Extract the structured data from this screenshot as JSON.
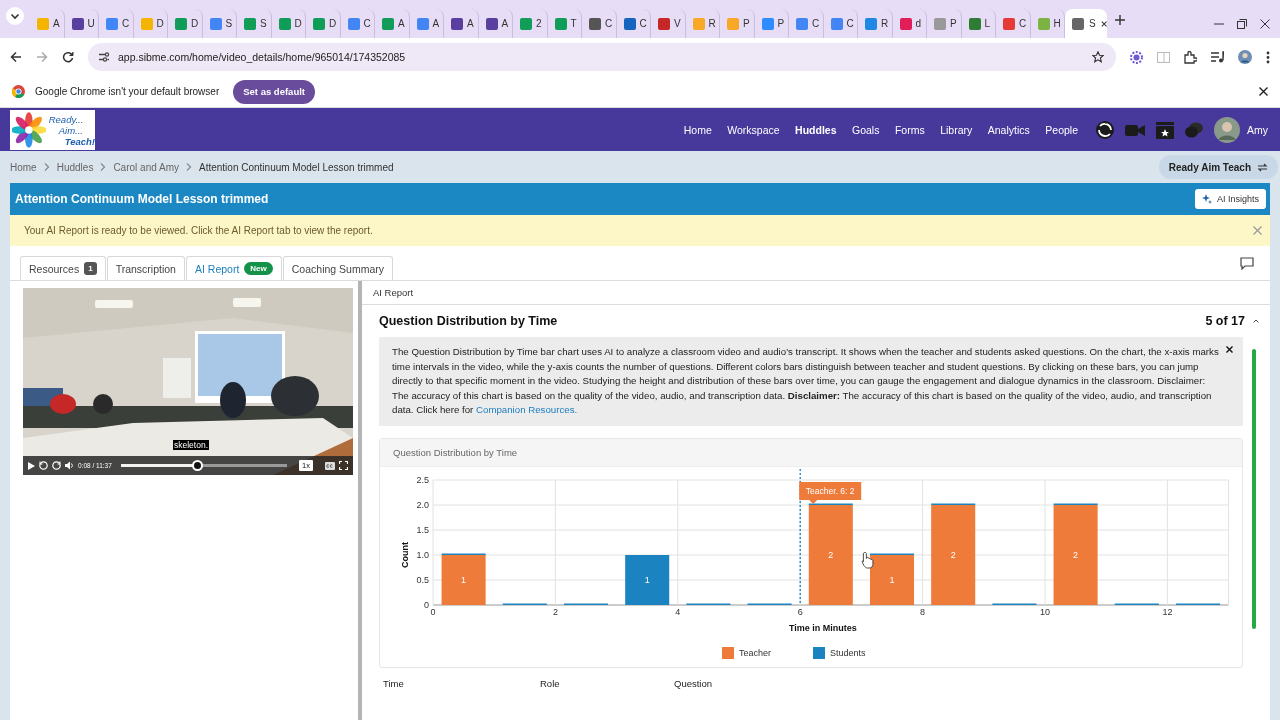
{
  "browser": {
    "tabs": [
      {
        "label": "A",
        "color": "#f4b400",
        "selected": false
      },
      {
        "label": "U",
        "color": "#5b3fa0",
        "selected": false
      },
      {
        "label": "C",
        "color": "#4285f4",
        "selected": false
      },
      {
        "label": "D",
        "color": "#f4b400",
        "selected": false
      },
      {
        "label": "D",
        "color": "#0f9d58",
        "selected": false
      },
      {
        "label": "S",
        "color": "#4285f4",
        "selected": false
      },
      {
        "label": "S",
        "color": "#0f9d58",
        "selected": false
      },
      {
        "label": "D",
        "color": "#0f9d58",
        "selected": false
      },
      {
        "label": "D",
        "color": "#0f9d58",
        "selected": false
      },
      {
        "label": "C",
        "color": "#4285f4",
        "selected": false
      },
      {
        "label": "A",
        "color": "#0f9d58",
        "selected": false
      },
      {
        "label": "A",
        "color": "#4285f4",
        "selected": false
      },
      {
        "label": "A",
        "color": "#5b3fa0",
        "selected": false
      },
      {
        "label": "A",
        "color": "#5b3fa0",
        "selected": false
      },
      {
        "label": "2",
        "color": "#0f9d58",
        "selected": false
      },
      {
        "label": "T",
        "color": "#0f9d58",
        "selected": false
      },
      {
        "label": "C",
        "color": "#555555",
        "selected": false
      },
      {
        "label": "C",
        "color": "#1565c0",
        "selected": false
      },
      {
        "label": "V",
        "color": "#c62828",
        "selected": false
      },
      {
        "label": "R",
        "color": "#f9a825",
        "selected": false
      },
      {
        "label": "P",
        "color": "#f9a825",
        "selected": false
      },
      {
        "label": "P",
        "color": "#2d8cff",
        "selected": false
      },
      {
        "label": "C",
        "color": "#4285f4",
        "selected": false
      },
      {
        "label": "C",
        "color": "#4285f4",
        "selected": false
      },
      {
        "label": "R",
        "color": "#1e88e5",
        "selected": false
      },
      {
        "label": "d",
        "color": "#e01e5a",
        "selected": false
      },
      {
        "label": "P",
        "color": "#999999",
        "selected": false
      },
      {
        "label": "L",
        "color": "#2e7d32",
        "selected": false
      },
      {
        "label": "C",
        "color": "#e53935",
        "selected": false
      },
      {
        "label": "H",
        "color": "#7cb342",
        "selected": false
      },
      {
        "label": "S",
        "color": "#666666",
        "selected": true
      }
    ],
    "url": "app.sibme.com/home/video_details/home/965014/174352085",
    "default_bar": {
      "message": "Google Chrome isn't your default browser",
      "button": "Set as default"
    }
  },
  "app": {
    "logo_lines": [
      "Ready...",
      "Aim...",
      "Teach!"
    ],
    "nav": [
      {
        "label": "Home",
        "selected": false
      },
      {
        "label": "Workspace",
        "selected": false
      },
      {
        "label": "Huddles",
        "selected": true
      },
      {
        "label": "Goals",
        "selected": false
      },
      {
        "label": "Forms",
        "selected": false
      },
      {
        "label": "Library",
        "selected": false
      },
      {
        "label": "Analytics",
        "selected": false
      },
      {
        "label": "People",
        "selected": false
      }
    ],
    "user": "Amy"
  },
  "breadcrumbs": [
    "Home",
    "Huddles",
    "Carol and Amy",
    "Attention Continuum Model Lesson trimmed"
  ],
  "workspace_button": "Ready Aim Teach",
  "title": "Attention Continuum Model Lesson trimmed",
  "insights_button": "AI Insights",
  "notice": "Your AI Report is ready to be viewed. Click the AI Report tab to view the report.",
  "tabs": [
    {
      "label": "Resources",
      "badge": "1",
      "selected": false
    },
    {
      "label": "Transcription",
      "selected": false
    },
    {
      "label": "AI Report",
      "badge": "New",
      "selected": true
    },
    {
      "label": "Coaching Summary",
      "selected": false
    }
  ],
  "video": {
    "caption": "skeleton.",
    "time": "0:08 / 11:37",
    "speed": "1x",
    "level": 0.46
  },
  "report": {
    "header": "AI Report",
    "section_title": "Question Distribution by Time",
    "counter": "5 of 17",
    "description": "The Question Distribution by Time bar chart uses AI to analyze a classroom video and audio's transcript. It shows when the teacher and students asked questions. On the chart, the x-axis marks time intervals in the video, while the y-axis counts the number of questions. Different colors bars distinguish between teacher and student questions. By clicking on these bars, you can jump directly to that specific moment in the video. Studying the height and distribution of these bars over time, you can gauge the engagement and dialogue dynamics in the classroom. Disclaimer: The accuracy of this chart is based on the quality of the video, audio, and transcription data. **Disclaimer:** The accuracy of this chart is based on the quality of the video, audio, and transcription data. Click here for ",
    "link": "Companion Resources.",
    "chart_data": {
      "type": "bar",
      "title": "Question Distribution by Time",
      "xlabel": "Time in Minutes",
      "ylabel": "Count",
      "x": [
        0.5,
        1.5,
        2.5,
        3.5,
        4.5,
        5.5,
        6.5,
        7.5,
        8.5,
        9.5,
        10.5,
        11.5,
        12.5
      ],
      "series": [
        {
          "name": "Teacher",
          "color": "#ef7b3b",
          "values": [
            1,
            0,
            0,
            0,
            0,
            0,
            2,
            1,
            2,
            0,
            2,
            0,
            0
          ],
          "value_labels": [
            "1",
            null,
            null,
            null,
            null,
            null,
            "2",
            "1",
            "2",
            null,
            "2",
            null,
            null
          ]
        },
        {
          "name": "Students",
          "color": "#1b84c0",
          "values": [
            0,
            0,
            0,
            1,
            0,
            0,
            0,
            0,
            0,
            0,
            0,
            0,
            0
          ],
          "value_labels": [
            null,
            null,
            null,
            "1",
            null,
            null,
            null,
            null,
            null,
            null,
            null,
            null,
            null
          ]
        }
      ],
      "xlim": [
        0,
        13
      ],
      "ylim": [
        0,
        2.5
      ],
      "xticks": [
        0,
        2,
        4,
        6,
        8,
        10,
        12
      ],
      "yticks": [
        {
          "value": 0,
          "label": "0"
        },
        {
          "value": 0.5,
          "label": "0.5"
        },
        {
          "value": 1,
          "label": "1.0"
        },
        {
          "value": 1.5,
          "label": "1.5"
        },
        {
          "value": 2,
          "label": "2.0"
        },
        {
          "value": 2.5,
          "label": "2.5"
        }
      ],
      "stacked": true,
      "grid": true,
      "legend": "bottom",
      "ref_lines": [
        {
          "axis": "x",
          "value": 6
        }
      ],
      "annotations": [
        {
          "x": 6,
          "y": 2,
          "text": "Teacher. 6: 2"
        }
      ]
    },
    "table_columns": [
      "Time",
      "Role",
      "Question"
    ]
  }
}
